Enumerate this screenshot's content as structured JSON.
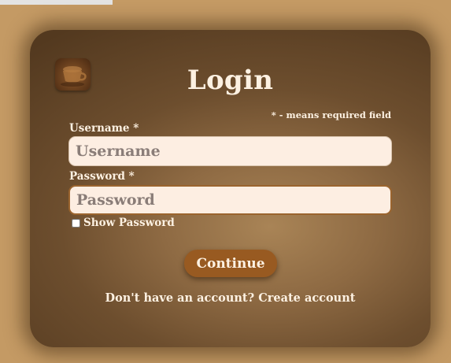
{
  "login": {
    "title": "Login",
    "required_note": "* - means required field",
    "logo_icon": "coffee-cup-icon",
    "username_label": "Username *",
    "username_placeholder": "Username",
    "password_label": "Password *",
    "password_placeholder": "Password",
    "show_password_label": "Show Password",
    "show_password_checked": false,
    "continue_label": "Continue",
    "signup_prompt": "Don't have an account?",
    "signup_link": "Create account"
  },
  "colors": {
    "page_background": "#c49a64",
    "card_dark": "#53391f",
    "card_light": "#a98456",
    "button": "#985a21",
    "input_background": "#fdeee2",
    "text": "#fdf1e2"
  }
}
